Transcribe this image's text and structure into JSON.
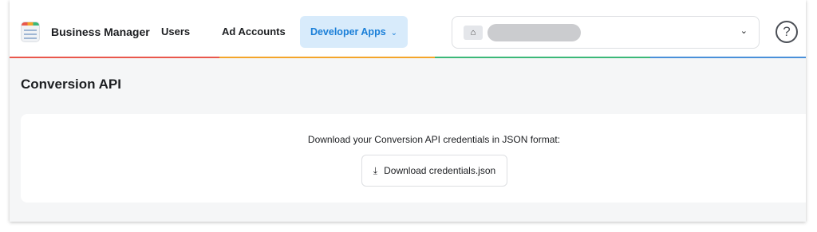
{
  "header": {
    "brand_name": "Business Manager",
    "nav": {
      "users": "Users",
      "ad_accounts": "Ad Accounts",
      "developer_apps": "Developer Apps"
    },
    "account_icon": "store-icon",
    "help_symbol": "?"
  },
  "page": {
    "title": "Conversion API",
    "description": "Download your Conversion API credentials in JSON format:",
    "download_button": "Download credentials.json"
  },
  "colors": {
    "accent_red": "#e9584c",
    "accent_orange": "#f4a52a",
    "accent_green": "#3cb878",
    "accent_blue": "#4a90d9",
    "active_tab_bg": "#d8ebfb",
    "active_tab_text": "#1a7fd8"
  }
}
